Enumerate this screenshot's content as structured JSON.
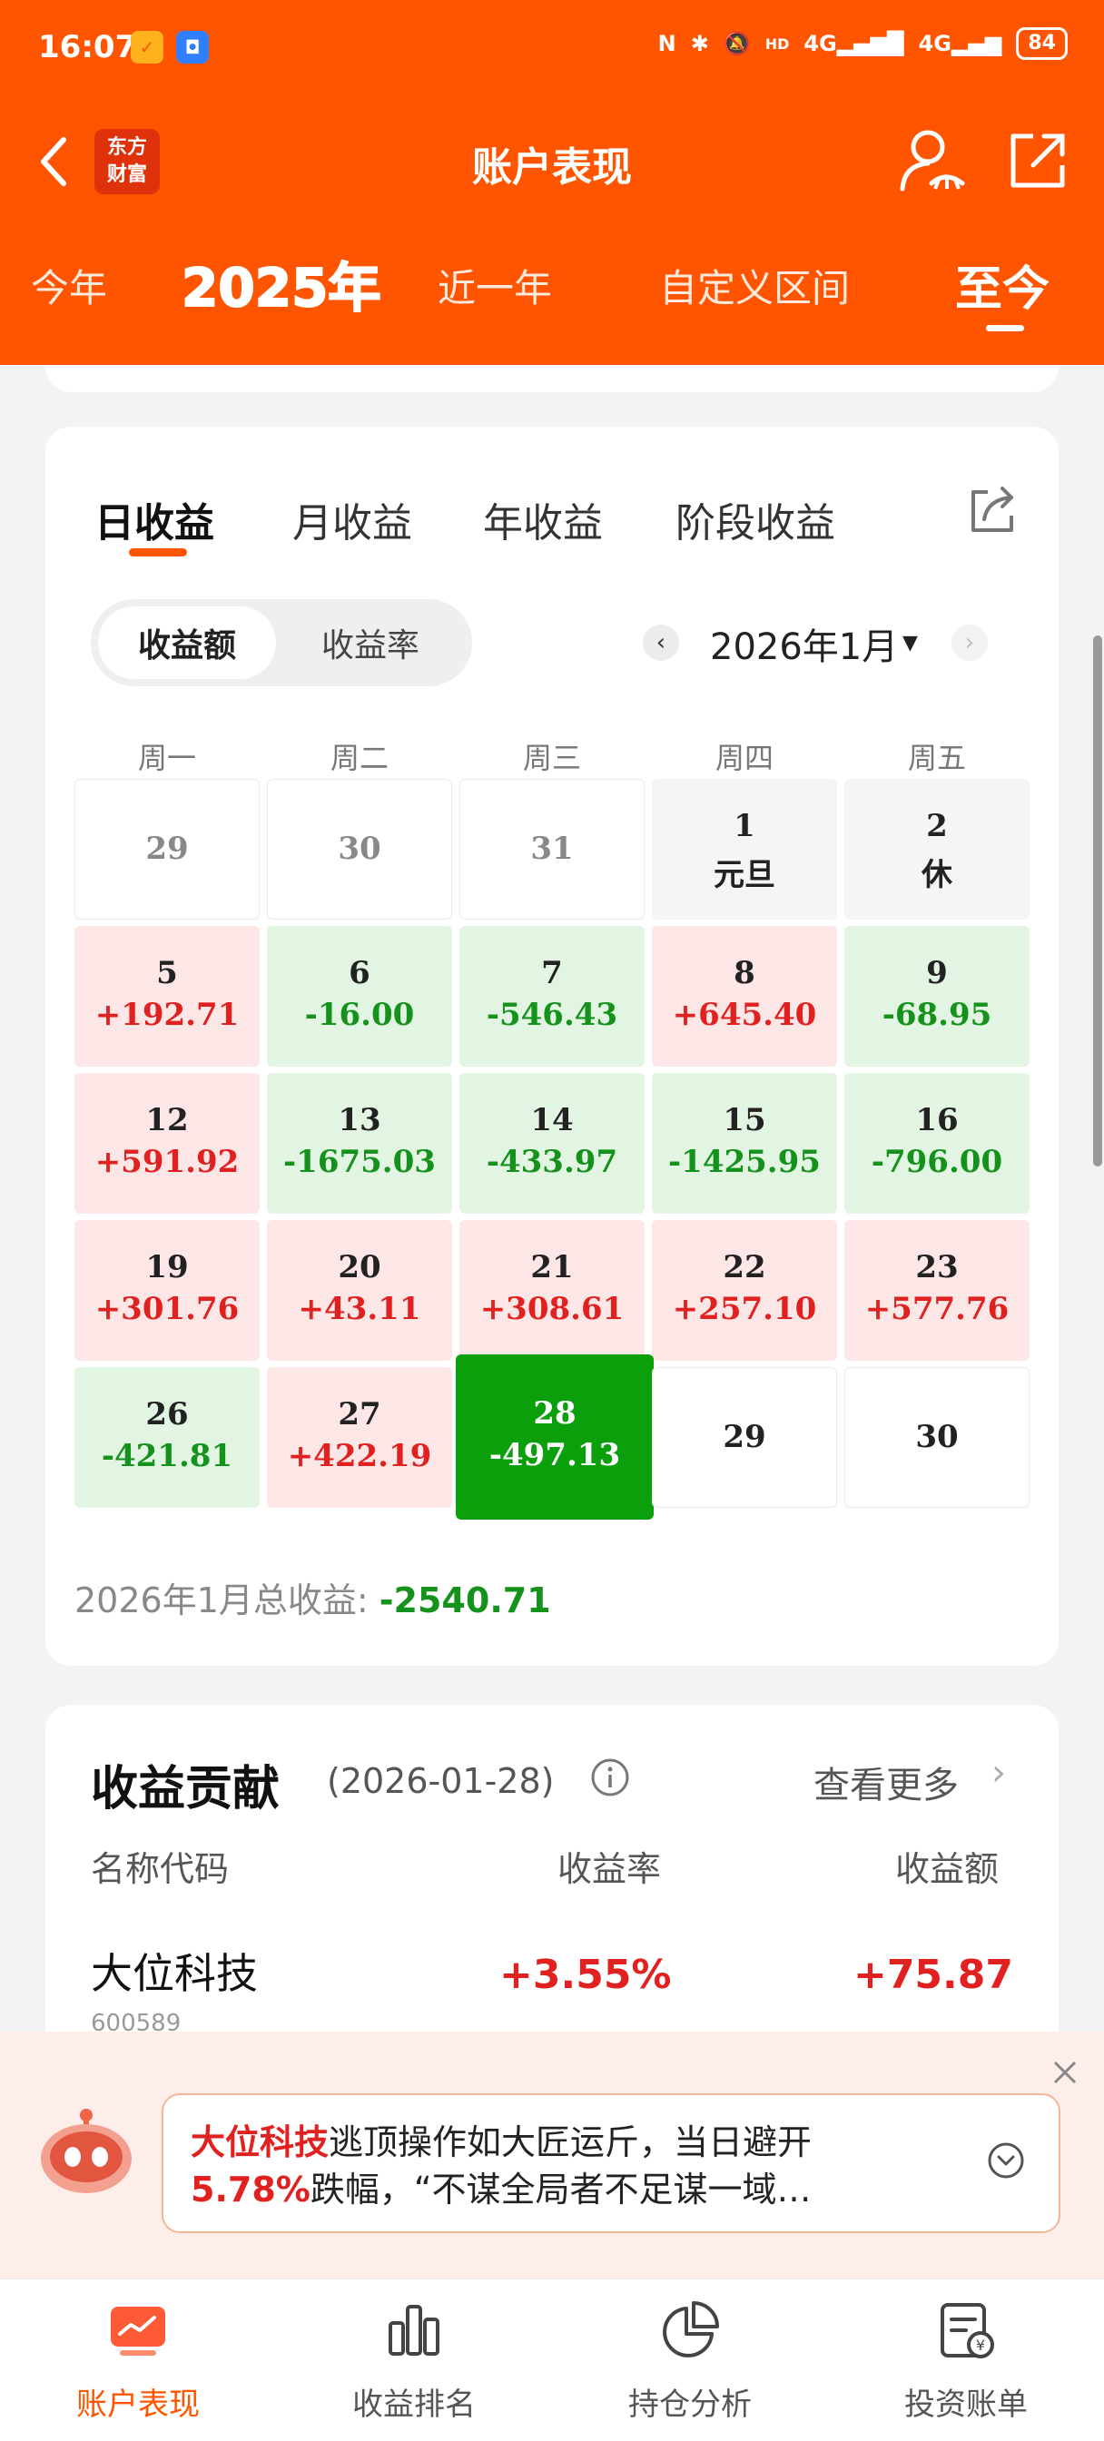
{
  "status_bar": {
    "time": "16:07",
    "network_1": "4G",
    "network_2": "4G",
    "battery": "84"
  },
  "header": {
    "back_icon": "chevron-left-icon",
    "logo_line1": "东方",
    "logo_line2": "财富",
    "title": "账户表现",
    "user_icon": "user-eye-icon",
    "share_icon": "share-icon"
  },
  "periods": [
    {
      "label": "今年"
    },
    {
      "label": "2025年"
    },
    {
      "label": "近一年"
    },
    {
      "label": "自定义区间"
    },
    {
      "label": "至今",
      "active": true
    }
  ],
  "earnings_tabs": [
    "日收益",
    "月收益",
    "年收益",
    "阶段收益"
  ],
  "segment": {
    "amount": "收益额",
    "rate": "收益率"
  },
  "month_nav": {
    "prev": "‹",
    "label": "2026年1月",
    "next": "›"
  },
  "weekdays": [
    "周一",
    "周二",
    "周三",
    "周四",
    "周五"
  ],
  "calendar": [
    {
      "day": "29",
      "value": "",
      "type": "empty past"
    },
    {
      "day": "30",
      "value": "",
      "type": "empty past"
    },
    {
      "day": "31",
      "value": "",
      "type": "empty past"
    },
    {
      "day": "1",
      "value": "元旦",
      "type": "grey note"
    },
    {
      "day": "2",
      "value": "休",
      "type": "grey note"
    },
    {
      "day": "5",
      "value": "+192.71",
      "type": "pos"
    },
    {
      "day": "6",
      "value": "-16.00",
      "type": "neg"
    },
    {
      "day": "7",
      "value": "-546.43",
      "type": "neg"
    },
    {
      "day": "8",
      "value": "+645.40",
      "type": "pos"
    },
    {
      "day": "9",
      "value": "-68.95",
      "type": "neg"
    },
    {
      "day": "12",
      "value": "+591.92",
      "type": "pos"
    },
    {
      "day": "13",
      "value": "-1675.03",
      "type": "neg"
    },
    {
      "day": "14",
      "value": "-433.97",
      "type": "neg"
    },
    {
      "day": "15",
      "value": "-1425.95",
      "type": "neg"
    },
    {
      "day": "16",
      "value": "-796.00",
      "type": "neg"
    },
    {
      "day": "19",
      "value": "+301.76",
      "type": "pos"
    },
    {
      "day": "20",
      "value": "+43.11",
      "type": "pos"
    },
    {
      "day": "21",
      "value": "+308.61",
      "type": "pos"
    },
    {
      "day": "22",
      "value": "+257.10",
      "type": "pos"
    },
    {
      "day": "23",
      "value": "+577.76",
      "type": "pos"
    },
    {
      "day": "26",
      "value": "-421.81",
      "type": "neg"
    },
    {
      "day": "27",
      "value": "+422.19",
      "type": "pos"
    },
    {
      "day": "28",
      "value": "-497.13",
      "type": "sel"
    },
    {
      "day": "29",
      "value": "",
      "type": "empty"
    },
    {
      "day": "30",
      "value": "",
      "type": "empty"
    }
  ],
  "month_total": {
    "label": "2026年1月总收益:",
    "value": "-2540.71"
  },
  "contribution": {
    "title": "收益贡献",
    "date": "(2026-01-28)",
    "more": "查看更多",
    "columns": {
      "name": "名称代码",
      "rate": "收益率",
      "amount": "收益额"
    },
    "rows": [
      {
        "name": "大位科技",
        "code": "600589",
        "rate": "+3.55%",
        "amount": "+75.87"
      }
    ]
  },
  "ai_tip": {
    "stock": "大位科技",
    "text_1": "逃顶操作如大匠运斤，当日避开",
    "pct": "5.78%",
    "text_2": "跌幅，“不谋全局者不足谋一域…"
  },
  "bottom_nav": [
    {
      "label": "账户表现",
      "icon": "chart-card-icon",
      "active": true
    },
    {
      "label": "收益排名",
      "icon": "bar-chart-icon"
    },
    {
      "label": "持仓分析",
      "icon": "pie-chart-icon"
    },
    {
      "label": "投资账单",
      "icon": "bill-icon"
    }
  ],
  "colors": {
    "brand": "#ff5500",
    "gain": "#e0211f",
    "loss": "#14921b",
    "gain_bg": "#fde6e6",
    "loss_bg": "#e2f4e2",
    "selected_bg": "#0c9f0c"
  }
}
